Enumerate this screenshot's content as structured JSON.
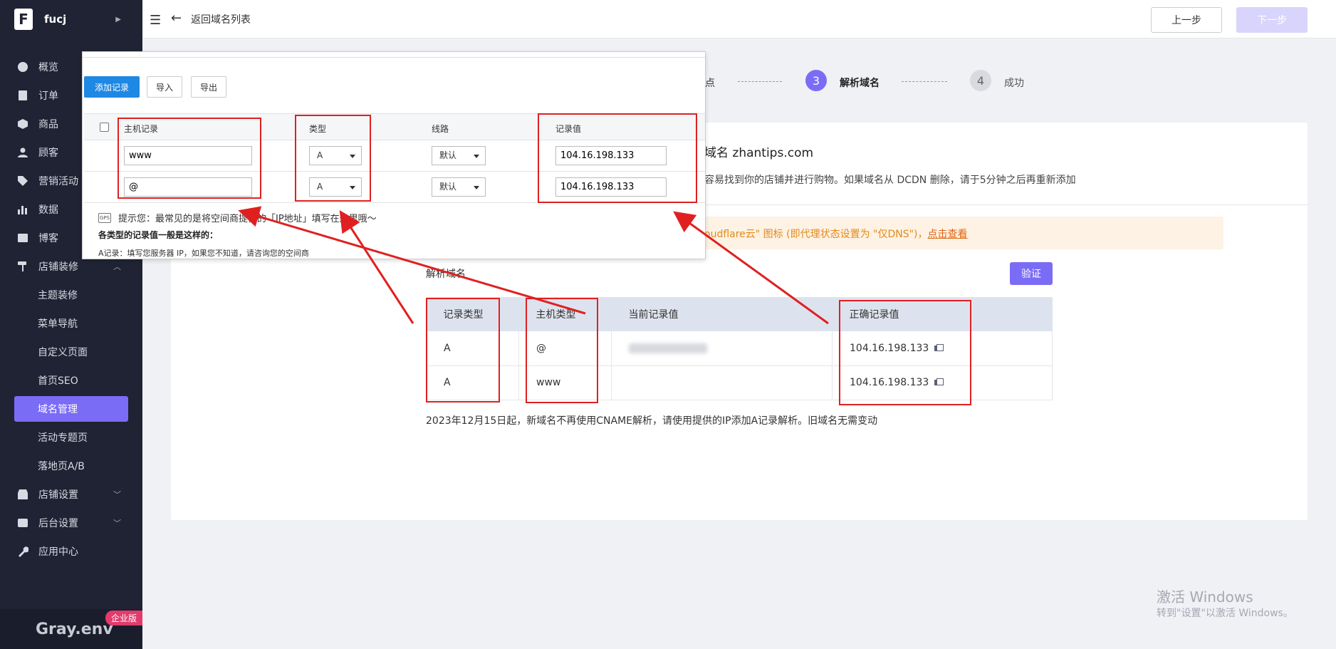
{
  "app": {
    "logo_letter": "F",
    "store_name": "fucj",
    "edition_badge": "企业版",
    "footer_brand": "Gray.env"
  },
  "topbar": {
    "back_label": "返回域名列表",
    "prev_label": "上一步",
    "next_label": "下一步"
  },
  "sidebar": {
    "items": [
      {
        "label": "概览",
        "icon": "gauge-icon"
      },
      {
        "label": "订单",
        "icon": "order-icon"
      },
      {
        "label": "商品",
        "icon": "box-icon"
      },
      {
        "label": "顾客",
        "icon": "user-icon"
      },
      {
        "label": "营销活动",
        "icon": "tag-icon"
      },
      {
        "label": "数据",
        "icon": "bar-chart-icon"
      },
      {
        "label": "博客",
        "icon": "blog-icon"
      },
      {
        "label": "店铺装修",
        "icon": "paint-roller-icon"
      }
    ],
    "sub_items": [
      {
        "label": "主题装修"
      },
      {
        "label": "菜单导航"
      },
      {
        "label": "自定义页面"
      },
      {
        "label": "首页SEO"
      },
      {
        "label": "域名管理"
      },
      {
        "label": "活动专题页"
      },
      {
        "label": "落地页A/B"
      }
    ],
    "bottom_items": [
      {
        "label": "店铺设置",
        "icon": "store-icon"
      },
      {
        "label": "后台设置",
        "icon": "settings-icon"
      },
      {
        "label": "应用中心",
        "icon": "wrench-icon"
      }
    ]
  },
  "steps": {
    "partial_label": "点",
    "step3": {
      "num": "3",
      "label": "解析域名"
    },
    "step4": {
      "num": "4",
      "label": "成功"
    },
    "active_color": "#7b6cf6"
  },
  "main": {
    "domain_title": "域名 zhantips.com",
    "domain_desc": "容易找到你的店铺并进行购物。如果域名从 DCDN 删除，请于5分钟之后再重新添加",
    "notice_text": "oudflare云\" 图标 (即代理状态设置为 \"仅DNS\")，",
    "notice_link": "点击查看",
    "section_label": "解析域名",
    "verify_label": "验证",
    "table": {
      "headers": [
        "记录类型",
        "主机类型",
        "当前记录值",
        "正确记录值"
      ],
      "rows": [
        {
          "type": "A",
          "host": "@",
          "correct": "104.16.198.133"
        },
        {
          "type": "A",
          "host": "www",
          "correct": "104.16.198.133"
        }
      ]
    },
    "note": "2023年12月15日起，新域名不再使用CNAME解析，请使用提供的IP添加A记录解析。旧域名无需变动"
  },
  "popup": {
    "add_label": "添加记录",
    "import_label": "导入",
    "export_label": "导出",
    "headers": {
      "host": "主机记录",
      "type": "类型",
      "line": "线路",
      "value": "记录值"
    },
    "rows": [
      {
        "host": "www",
        "type": "A",
        "line": "默认",
        "value": "104.16.198.133"
      },
      {
        "host": "@",
        "type": "A",
        "line": "默认",
        "value": "104.16.198.133"
      }
    ],
    "tip_icon": "GPS",
    "tip": "提示您：最常见的是将空间商提供的「IP地址」填写在这里哦～",
    "tip_bold": "各类型的记录值一般是这样的：",
    "tip_a": "A记录：填写您服务器 IP，如果您不知道，请咨询您的空间商"
  },
  "windows": {
    "title": "激活 Windows",
    "subtitle": "转到\"设置\"以激活 Windows。"
  },
  "colors": {
    "accent": "#7b6cf6",
    "annotation_red": "#e02020",
    "sidebar_bg": "#1f2333"
  }
}
